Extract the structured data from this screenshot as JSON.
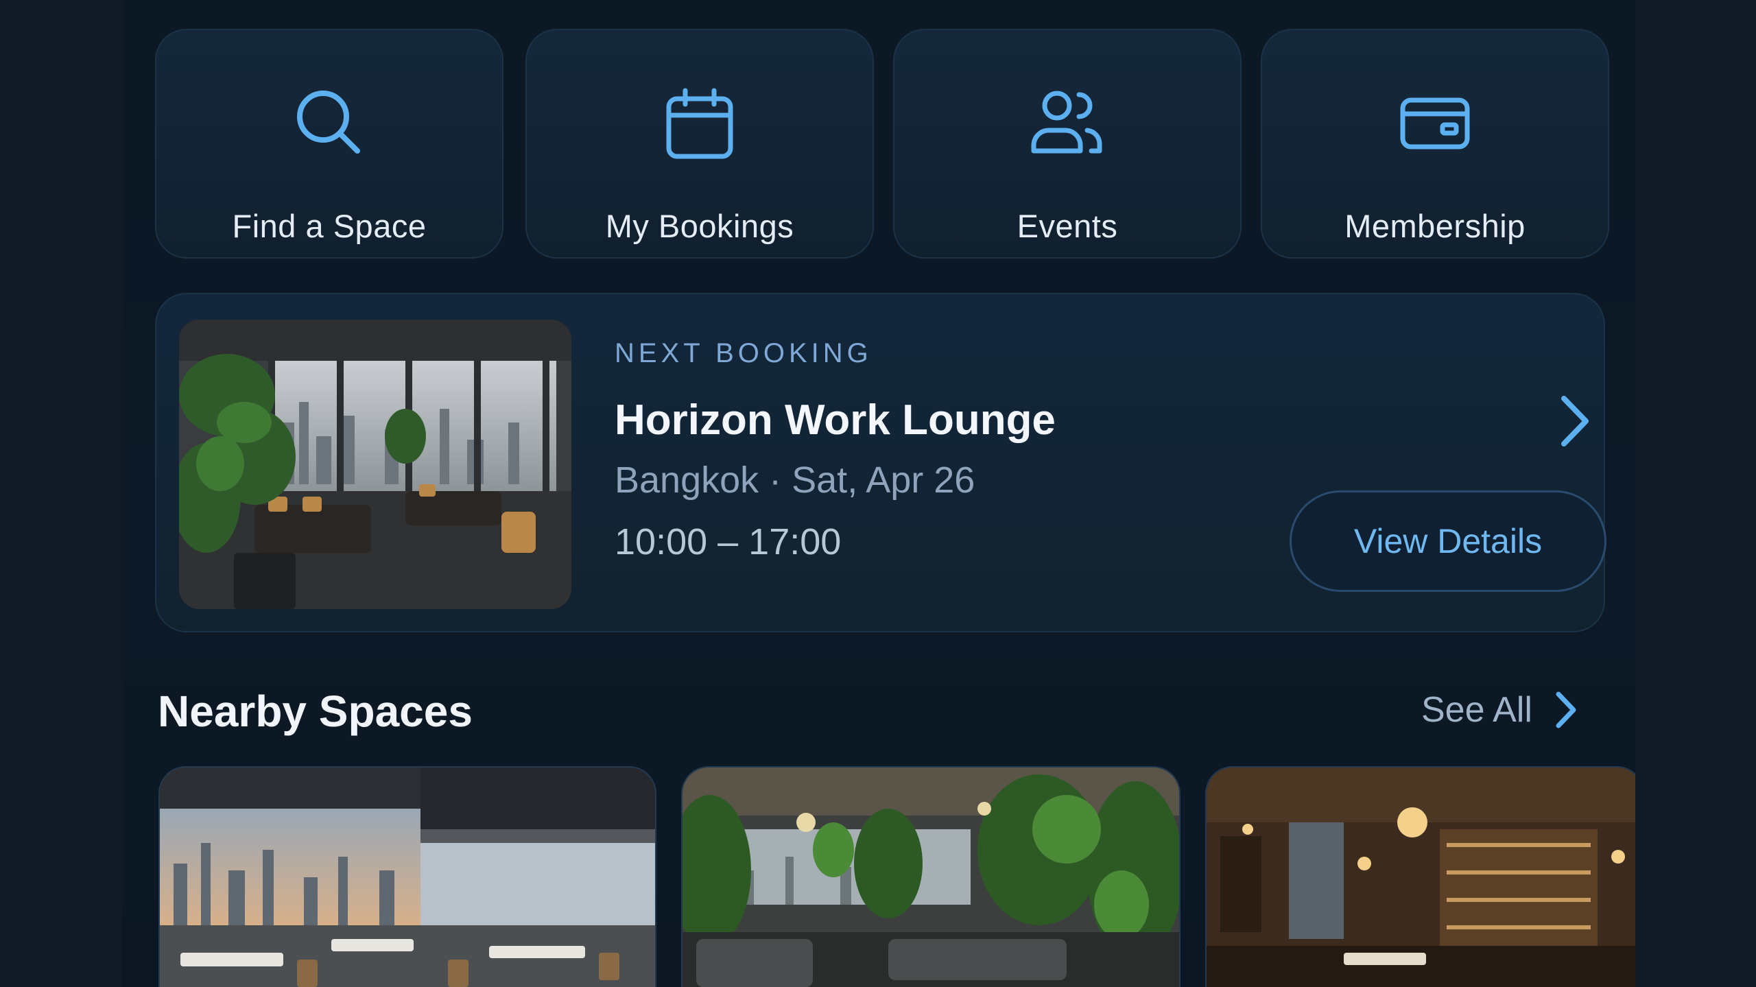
{
  "colors": {
    "background": "#0c1824",
    "card": "#13273b",
    "accent": "#5cb0f0",
    "eyebrow": "#7fa8d6"
  },
  "quick_actions": [
    {
      "label": "Find a Space",
      "icon": "search-icon"
    },
    {
      "label": "My Bookings",
      "icon": "calendar-icon"
    },
    {
      "label": "Events",
      "icon": "users-icon"
    },
    {
      "label": "Membership",
      "icon": "credit-card-icon"
    }
  ],
  "next_booking": {
    "eyebrow": "NEXT BOOKING",
    "title": "Horizon Work Lounge",
    "location_date": "Bangkok · Sat, Apr 26",
    "time": "10:00 – 17:00",
    "button": "View Details",
    "chevron_icon": "chevron-right-icon"
  },
  "nearby": {
    "title": "Nearby Spaces",
    "see_all": "See All",
    "see_all_icon": "chevron-right-icon",
    "cards": [
      {
        "image": "skyline-cafe-photo"
      },
      {
        "image": "garden-lounge-photo"
      },
      {
        "image": "warm-bar-lounge-photo"
      }
    ]
  }
}
